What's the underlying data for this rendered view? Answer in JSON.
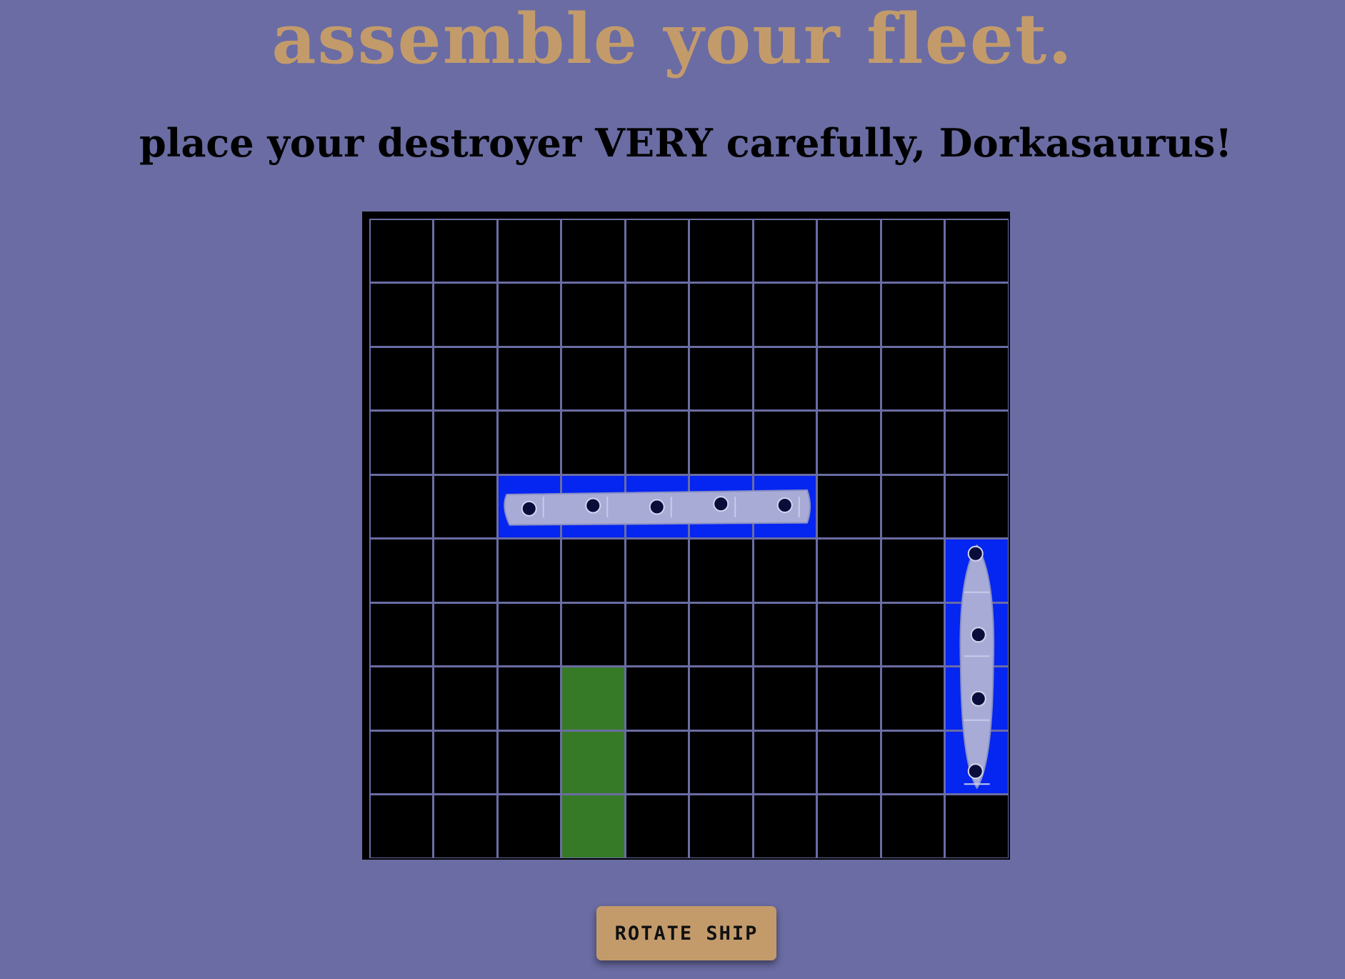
{
  "header": {
    "title": "assemble your fleet.",
    "instruction": "place your destroyer VERY carefully, Dorkasaurus!"
  },
  "board": {
    "rows": 10,
    "cols": 10,
    "cell_color": "#000000",
    "grid_line_color": "#6a6ca3",
    "placed_ship_color": "#0525f0",
    "placement_preview_color": "#367a27",
    "placed_ships": [
      {
        "name": "battleship",
        "icon": "battleship-icon",
        "row": 4,
        "col": 2,
        "length": 5,
        "orientation": "horizontal"
      },
      {
        "name": "cruiser",
        "icon": "cruiser-icon",
        "row": 5,
        "col": 9,
        "length": 4,
        "orientation": "vertical"
      }
    ],
    "placement_preview": {
      "row": 7,
      "col": 3,
      "length": 3,
      "orientation": "vertical"
    }
  },
  "controls": {
    "rotate_label": "ROTATE SHIP"
  },
  "colors": {
    "background": "#6a6ca3",
    "title": "#c39b6b",
    "button": "#c39b6b"
  }
}
